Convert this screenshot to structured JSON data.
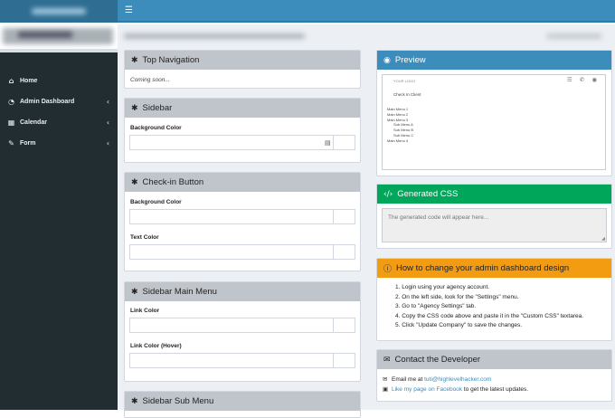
{
  "topbar": {
    "menu_icon": "hamburger-icon",
    "menu_glyph": "☰"
  },
  "sidebar": {
    "items": [
      {
        "label": "Home",
        "icon": "home-icon",
        "glyph": "⌂",
        "chevron": ""
      },
      {
        "label": "Admin Dashboard",
        "icon": "dashboard-icon",
        "glyph": "◔",
        "chevron": "‹"
      },
      {
        "label": "Calendar",
        "icon": "calendar-icon",
        "glyph": "▦",
        "chevron": "‹"
      },
      {
        "label": "Form",
        "icon": "edit-icon",
        "glyph": "✎",
        "chevron": "‹"
      }
    ]
  },
  "panels": {
    "top_nav": {
      "title": "Top Navigation",
      "body": "Coming soon..."
    },
    "sidebar": {
      "title": "Sidebar",
      "bg_label": "Background Color"
    },
    "checkin": {
      "title": "Check-in Button",
      "bg_label": "Background Color",
      "text_label": "Text Color"
    },
    "main_menu": {
      "title": "Sidebar Main Menu",
      "link_label": "Link Color",
      "hover_label": "Link Color (Hover)"
    },
    "sub_menu": {
      "title": "Sidebar Sub Menu"
    }
  },
  "gear_glyph": "✱",
  "preview": {
    "title": "Preview",
    "logo": "YOUR LOGO",
    "icons": "☰ ✆ ◉",
    "checkin": "Check In Client",
    "menu": [
      "Main Menu 1",
      "Main Menu 2",
      "Main Menu 3"
    ],
    "submenu": [
      "Sub Menu A",
      "Sub Menu B",
      "Sub Menu C"
    ],
    "menu_last": "Main Menu 4"
  },
  "generated": {
    "title": "Generated CSS",
    "placeholder": "The generated code will appear here..."
  },
  "howto": {
    "title": "How to change your admin dashboard design",
    "steps": [
      "1. Login using your agency account.",
      "2. On the left side, look for the \"Settings\" menu.",
      "3. Go to \"Agency Settings\" tab.",
      "4. Copy the CSS code above and paste it in the \"Custom CSS\" textarea.",
      "5. Click \"Update Company\" to save the changes."
    ]
  },
  "contact": {
    "title": "Contact the Developer",
    "email_prefix": "Email me at ",
    "email": "tuti@highlevelhacker.com",
    "fb_link": "Like my page on Facebook",
    "fb_suffix": " to get the latest updates."
  }
}
